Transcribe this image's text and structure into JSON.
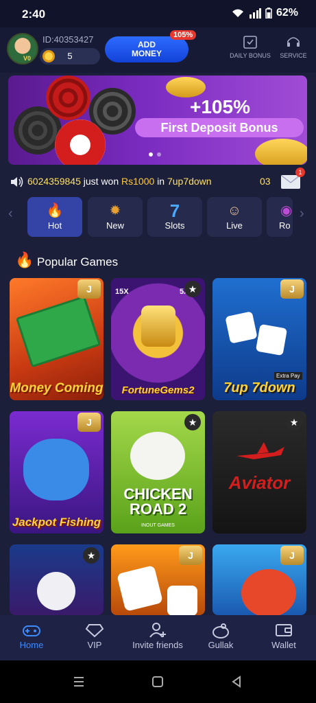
{
  "status": {
    "time": "2:40",
    "battery": "62%"
  },
  "header": {
    "user_id": "ID:40353427",
    "level": "V0",
    "balance": "5",
    "add_money_line1": "ADD",
    "add_money_line2": "MONEY",
    "add_money_badge": "105%",
    "daily_bonus_label": "DAILY BONUS",
    "service_label": "SERVICE"
  },
  "banner": {
    "percent": "+105%",
    "text": "First Deposit Bonus"
  },
  "marquee": {
    "prefix": "6024359845",
    "just_won": " just won ",
    "amount": "Rs1000",
    "in": " in ",
    "game": "7up7down",
    "right": "03",
    "mail_badge": "1"
  },
  "categories": [
    {
      "label": "Hot",
      "icon": "flame-icon"
    },
    {
      "label": "New",
      "icon": "new-badge-icon"
    },
    {
      "label": "Slots",
      "icon": "seven-icon"
    },
    {
      "label": "Live",
      "icon": "dealer-icon"
    },
    {
      "label": "Ro",
      "icon": "roulette-icon"
    }
  ],
  "popular": {
    "title": "Popular Games",
    "games": [
      {
        "name": "Money Coming",
        "badge": "J"
      },
      {
        "name": "FortuneGems2",
        "badge": "star"
      },
      {
        "name": "7up 7down",
        "badge": "J"
      },
      {
        "name": "Jackpot Fishing",
        "badge": "J"
      },
      {
        "name": "CHICKEN ROAD 2",
        "badge": "star"
      },
      {
        "name": "Aviator",
        "badge": "star"
      },
      {
        "name": "",
        "badge": "star"
      },
      {
        "name": "",
        "badge": "J"
      },
      {
        "name": "",
        "badge": "J"
      }
    ],
    "extra": {
      "fortune_multipliers": "15X",
      "fortune_5x": "5X",
      "extra_pay": "Extra Pay",
      "chicken_sub": "INOUT GAMES"
    }
  },
  "nav": [
    {
      "label": "Home",
      "icon": "gamepad-icon",
      "active": true
    },
    {
      "label": "VIP",
      "icon": "diamond-icon",
      "active": false
    },
    {
      "label": "Invite friends",
      "icon": "add-user-icon",
      "active": false
    },
    {
      "label": "Gullak",
      "icon": "piggy-bank-icon",
      "active": false
    },
    {
      "label": "Wallet",
      "icon": "wallet-icon",
      "active": false
    }
  ]
}
